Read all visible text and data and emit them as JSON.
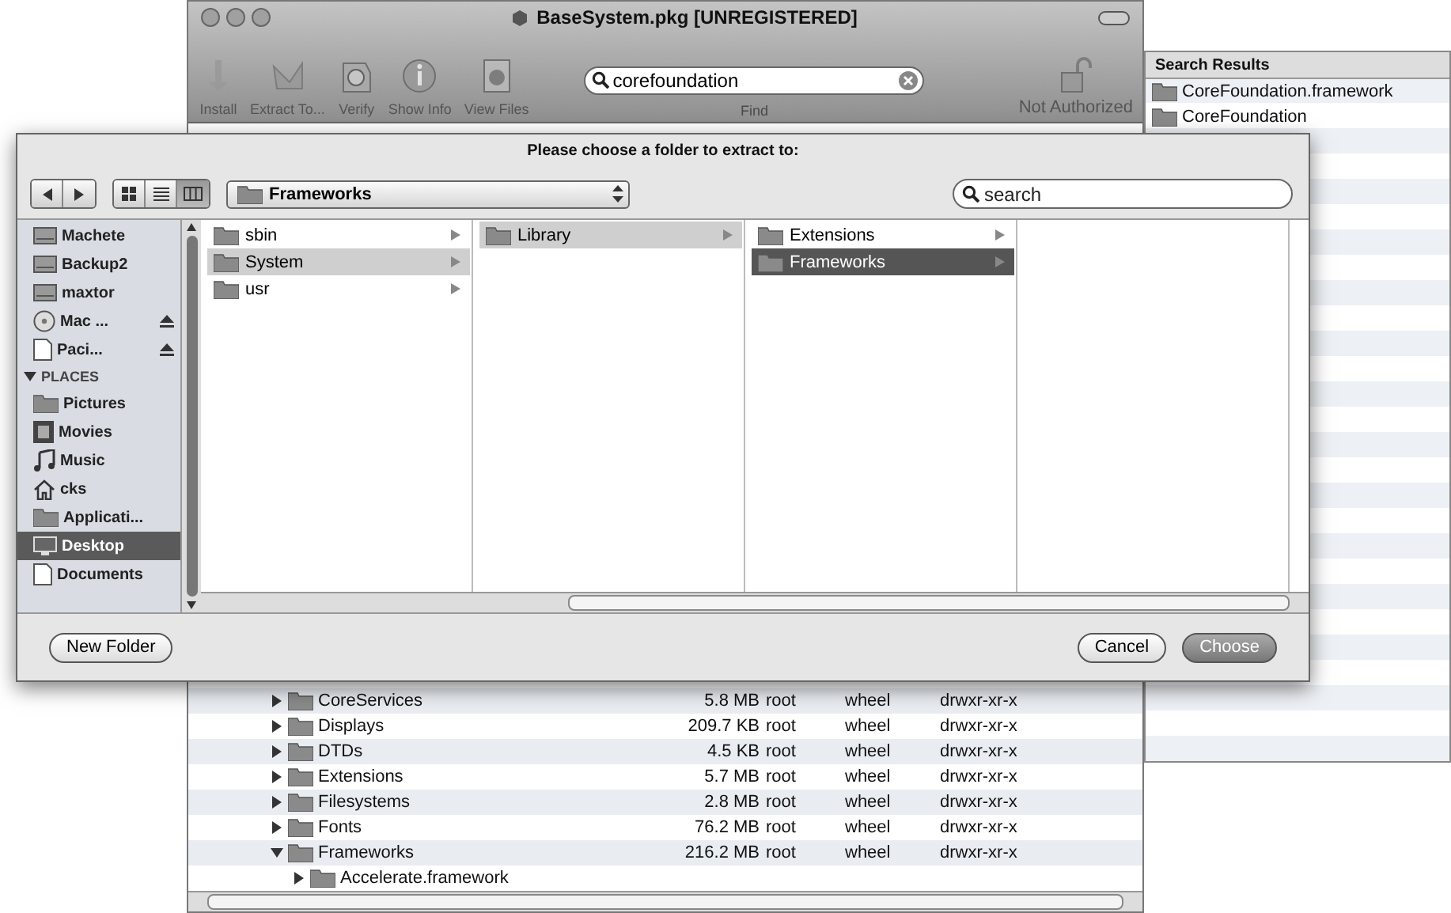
{
  "window": {
    "title": "BaseSystem.pkg [UNREGISTERED]",
    "toolbar": [
      {
        "label": "Install"
      },
      {
        "label": "Extract To..."
      },
      {
        "label": "Verify"
      },
      {
        "label": "Show Info"
      },
      {
        "label": "View Files"
      }
    ],
    "search": {
      "value": "corefoundation",
      "label": "Find"
    },
    "lock": {
      "label": "Not Authorized"
    }
  },
  "files": {
    "rows": [
      {
        "name": "CoreServices",
        "size": "5.8 MB",
        "owner": "root",
        "group": "wheel",
        "permissions": "drwxr-xr-x",
        "expanded": false
      },
      {
        "name": "Displays",
        "size": "209.7 KB",
        "owner": "root",
        "group": "wheel",
        "permissions": "drwxr-xr-x",
        "expanded": false
      },
      {
        "name": "DTDs",
        "size": "4.5 KB",
        "owner": "root",
        "group": "wheel",
        "permissions": "drwxr-xr-x",
        "expanded": false
      },
      {
        "name": "Extensions",
        "size": "5.7 MB",
        "owner": "root",
        "group": "wheel",
        "permissions": "drwxr-xr-x",
        "expanded": false
      },
      {
        "name": "Filesystems",
        "size": "2.8 MB",
        "owner": "root",
        "group": "wheel",
        "permissions": "drwxr-xr-x",
        "expanded": false
      },
      {
        "name": "Fonts",
        "size": "76.2 MB",
        "owner": "root",
        "group": "wheel",
        "permissions": "drwxr-xr-x",
        "expanded": false
      },
      {
        "name": "Frameworks",
        "size": "216.2 MB",
        "owner": "root",
        "group": "wheel",
        "permissions": "drwxr-xr-x",
        "expanded": true,
        "children": [
          {
            "name": "Accelerate.framework",
            "expanded": false
          }
        ]
      }
    ]
  },
  "search_results": {
    "title": "Search Results",
    "items": [
      "CoreFoundation.framework",
      "CoreFoundation"
    ]
  },
  "dialog": {
    "title": "Please choose a folder to extract to:",
    "view_modes": [
      {
        "kind": "icon",
        "selected": false
      },
      {
        "kind": "list",
        "selected": false
      },
      {
        "kind": "column",
        "selected": true
      }
    ],
    "path": "Frameworks",
    "search": {
      "placeholder": "search"
    },
    "sidebar": {
      "devices": [
        {
          "label": "Machete",
          "kind": "drive",
          "ejectable": false,
          "selected": false
        },
        {
          "label": "Backup2",
          "kind": "drive",
          "ejectable": false,
          "selected": false
        },
        {
          "label": "maxtor",
          "kind": "drive",
          "ejectable": false,
          "selected": false
        },
        {
          "label": "Mac ...",
          "kind": "disc",
          "ejectable": true,
          "selected": false
        },
        {
          "label": "Paci...",
          "kind": "document",
          "ejectable": true,
          "selected": false
        }
      ],
      "places": {
        "title": "PLACES",
        "expanded": true,
        "items": [
          {
            "label": "Pictures",
            "kind": "folder",
            "selected": false
          },
          {
            "label": "Movies",
            "kind": "film",
            "selected": false
          },
          {
            "label": "Music",
            "kind": "music",
            "selected": false
          },
          {
            "label": "cks",
            "kind": "home",
            "selected": false
          },
          {
            "label": "Applicati...",
            "kind": "folder",
            "selected": false
          },
          {
            "label": "Desktop",
            "kind": "desktop",
            "selected": true
          },
          {
            "label": "Documents",
            "kind": "document",
            "selected": false
          }
        ]
      }
    },
    "columns": [
      [
        {
          "label": "sbin",
          "selected": false
        },
        {
          "label": "System",
          "selected": true
        },
        {
          "label": "usr",
          "selected": false
        }
      ],
      [
        {
          "label": "Library",
          "selected": true
        }
      ],
      [
        {
          "label": "Extensions",
          "selected": false
        },
        {
          "label": "Frameworks",
          "selected": true
        }
      ]
    ],
    "buttons": {
      "new_folder": "New Folder",
      "cancel": "Cancel",
      "choose": "Choose"
    }
  }
}
